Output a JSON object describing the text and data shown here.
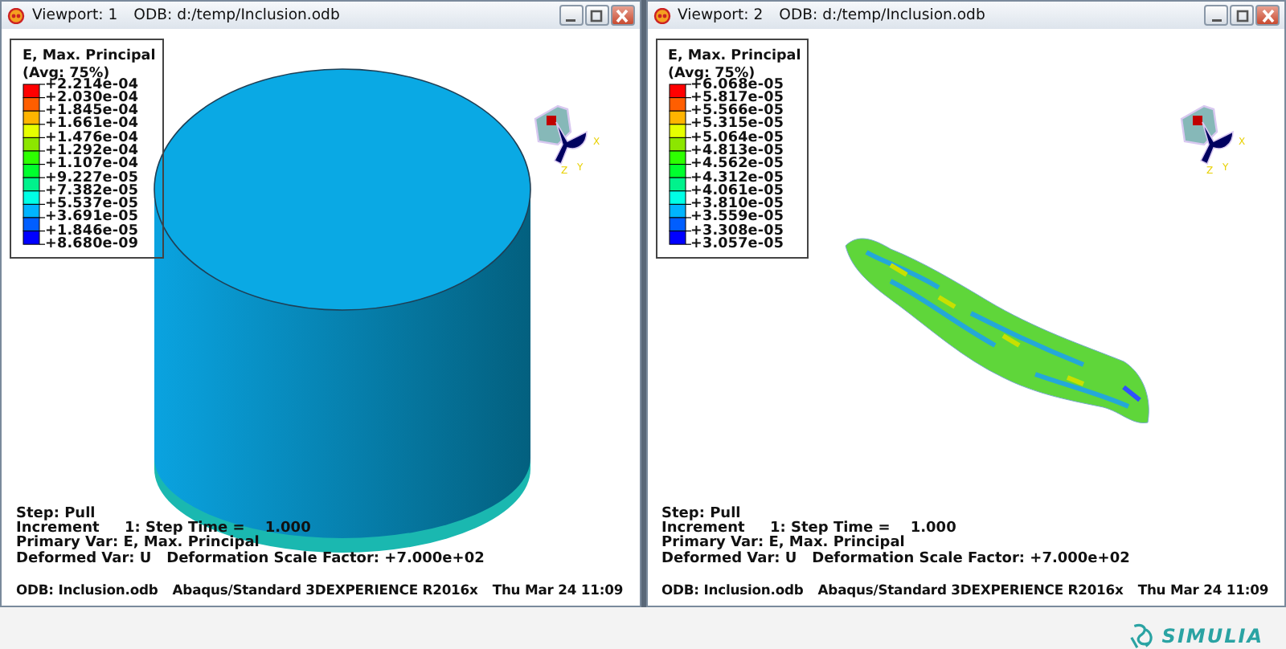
{
  "viewports": [
    {
      "title": "Viewport: 1",
      "odb_path": "ODB: d:/temp/Inclusion.odb",
      "model": {
        "kind": "cylinder"
      },
      "legend": {
        "title": "E, Max. Principal",
        "subtitle": "(Avg: 75%)",
        "values": [
          "+2.214e-04",
          "+2.030e-04",
          "+1.845e-04",
          "+1.661e-04",
          "+1.476e-04",
          "+1.292e-04",
          "+1.107e-04",
          "+9.227e-05",
          "+7.382e-05",
          "+5.537e-05",
          "+3.691e-05",
          "+1.846e-05",
          "+8.680e-09"
        ]
      },
      "triad_labels": [
        "X",
        "Y",
        "Z"
      ],
      "info_lines": [
        "Step: Pull",
        "Increment     1: Step Time =    1.000",
        "Primary Var: E, Max. Principal",
        "Deformed Var: U   Deformation Scale Factor: +7.000e+02"
      ],
      "footer": {
        "odb": "ODB: Inclusion.odb",
        "solver": "Abaqus/Standard 3DEXPERIENCE R2016x",
        "date": "Thu Mar 24 11:09"
      }
    },
    {
      "title": "Viewport: 2",
      "odb_path": "ODB: d:/temp/Inclusion.odb",
      "model": {
        "kind": "inclusion"
      },
      "legend": {
        "title": "E, Max. Principal",
        "subtitle": "(Avg: 75%)",
        "values": [
          "+6.068e-05",
          "+5.817e-05",
          "+5.566e-05",
          "+5.315e-05",
          "+5.064e-05",
          "+4.813e-05",
          "+4.562e-05",
          "+4.312e-05",
          "+4.061e-05",
          "+3.810e-05",
          "+3.559e-05",
          "+3.308e-05",
          "+3.057e-05"
        ]
      },
      "triad_labels": [
        "X",
        "Y",
        "Z"
      ],
      "info_lines": [
        "Step: Pull",
        "Increment     1: Step Time =    1.000",
        "Primary Var: E, Max. Principal",
        "Deformed Var: U   Deformation Scale Factor: +7.000e+02"
      ],
      "footer": {
        "odb": "ODB: Inclusion.odb",
        "solver": "Abaqus/Standard 3DEXPERIENCE R2016x",
        "date": "Thu Mar 24 11:09"
      }
    }
  ],
  "brand": "SIMULIA"
}
